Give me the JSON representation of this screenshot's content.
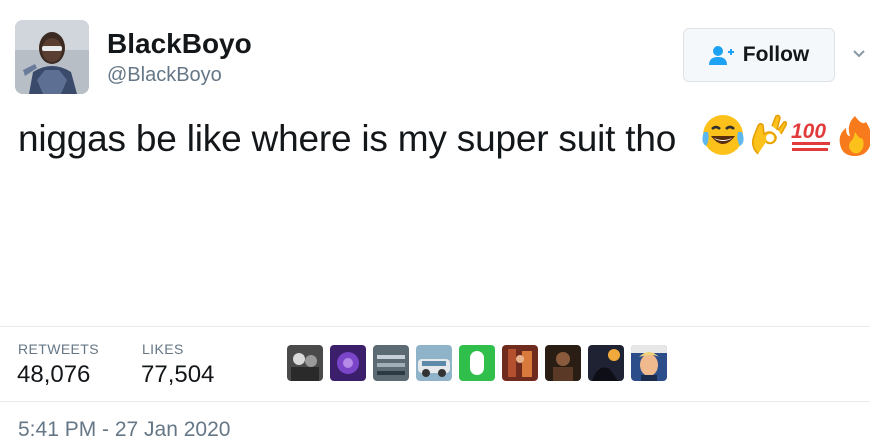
{
  "user": {
    "name": "BlackBoyo",
    "handle": "@BlackBoyo"
  },
  "follow_button": {
    "label": "Follow",
    "icon": "add-user-icon"
  },
  "tweet": {
    "text": "niggas be like where is my super suit tho",
    "emojis": [
      "face-with-tears-of-joy",
      "ok-hand",
      "hundred-points",
      "fire"
    ]
  },
  "stats": {
    "retweets_label": "RETWEETS",
    "retweets_value": "48,076",
    "likes_label": "LIKES",
    "likes_value": "77,504"
  },
  "liked_by_count_shown": 9,
  "timestamp": "5:41 PM - 27 Jan 2020",
  "colors": {
    "text": "#14171a",
    "muted": "#657786",
    "accent": "#1da1f2",
    "divider": "#e6ecf0"
  }
}
